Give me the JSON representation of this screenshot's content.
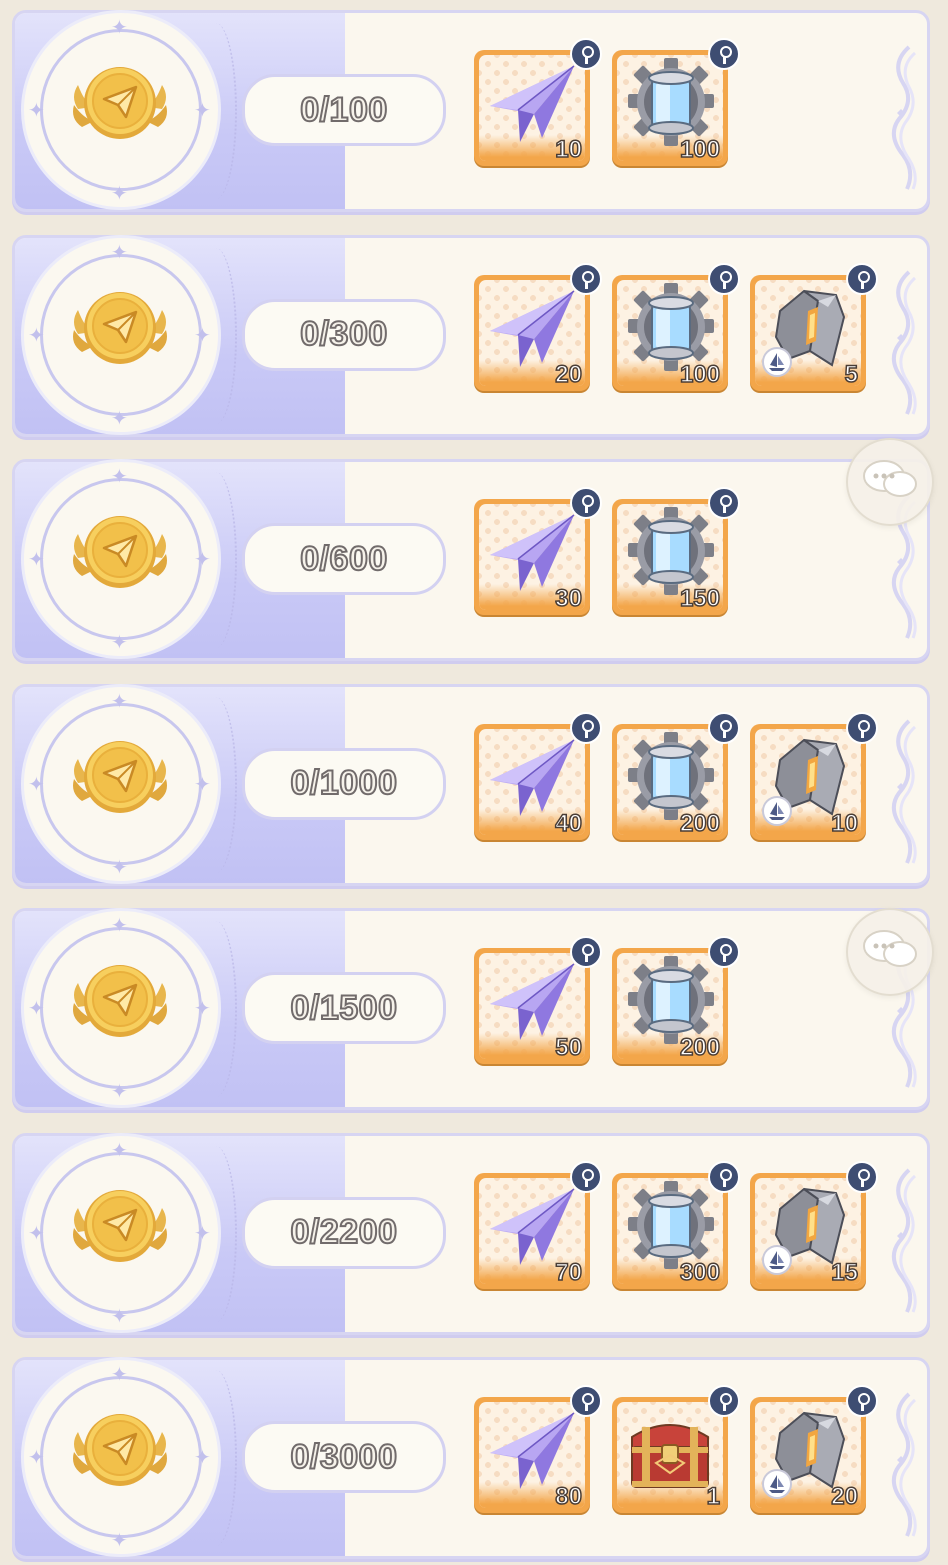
{
  "tiers": [
    {
      "progress": "0/100",
      "rewards": [
        {
          "item": "paper-plane-icon",
          "quantity": "10"
        },
        {
          "item": "gear-canister-icon",
          "quantity": "100"
        }
      ]
    },
    {
      "progress": "0/300",
      "rewards": [
        {
          "item": "paper-plane-icon",
          "quantity": "20"
        },
        {
          "item": "gear-canister-icon",
          "quantity": "100"
        },
        {
          "item": "ore-chunk-icon",
          "quantity": "5"
        }
      ]
    },
    {
      "progress": "0/600",
      "rewards": [
        {
          "item": "paper-plane-icon",
          "quantity": "30"
        },
        {
          "item": "gear-canister-icon",
          "quantity": "150"
        }
      ]
    },
    {
      "progress": "0/1000",
      "rewards": [
        {
          "item": "paper-plane-icon",
          "quantity": "40"
        },
        {
          "item": "gear-canister-icon",
          "quantity": "200"
        },
        {
          "item": "ore-chunk-icon",
          "quantity": "10"
        }
      ]
    },
    {
      "progress": "0/1500",
      "rewards": [
        {
          "item": "paper-plane-icon",
          "quantity": "50"
        },
        {
          "item": "gear-canister-icon",
          "quantity": "200"
        }
      ]
    },
    {
      "progress": "0/2200",
      "rewards": [
        {
          "item": "paper-plane-icon",
          "quantity": "70"
        },
        {
          "item": "gear-canister-icon",
          "quantity": "300"
        },
        {
          "item": "ore-chunk-icon",
          "quantity": "15"
        }
      ]
    },
    {
      "progress": "0/3000",
      "rewards": [
        {
          "item": "paper-plane-icon",
          "quantity": "80"
        },
        {
          "item": "treasure-chest-icon",
          "quantity": "1"
        },
        {
          "item": "ore-chunk-icon",
          "quantity": "20"
        }
      ]
    }
  ],
  "colors": {
    "panel": "#fbf7ee",
    "left_band": "#c9c9f6",
    "reward_frame": "#f3a64a",
    "info_badge": "#3e4d72"
  }
}
